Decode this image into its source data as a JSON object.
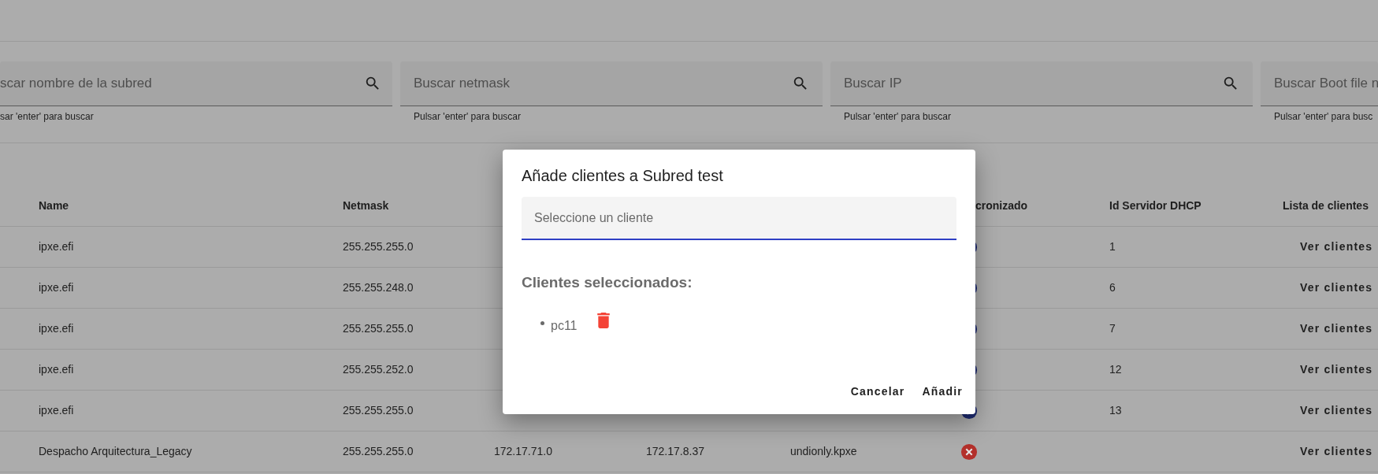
{
  "search_fields": [
    {
      "placeholder": "scar nombre de la subred",
      "helper": "sar 'enter' para buscar"
    },
    {
      "placeholder": "Buscar netmask",
      "helper": "Pulsar 'enter' para buscar"
    },
    {
      "placeholder": "Buscar IP",
      "helper": "Pulsar 'enter' para buscar"
    },
    {
      "placeholder": "Buscar Boot file n",
      "helper": "Pulsar 'enter' para busc"
    }
  ],
  "table": {
    "header": {
      "name": "Name",
      "netmask": "Netmask",
      "synced": "cronizado",
      "dhcp_id": "Id Servidor DHCP",
      "clients": "Lista de clientes"
    },
    "rows": [
      {
        "name": "ipxe.efi",
        "netmask": "255.255.255.0",
        "synced": true,
        "dhcp_id": "1",
        "action": "Ver clientes"
      },
      {
        "name": "ipxe.efi",
        "netmask": "255.255.248.0",
        "synced": true,
        "dhcp_id": "6",
        "action": "Ver clientes"
      },
      {
        "name": "ipxe.efi",
        "netmask": "255.255.255.0",
        "synced": true,
        "dhcp_id": "7",
        "action": "Ver clientes"
      },
      {
        "name": "ipxe.efi",
        "netmask": "255.255.252.0",
        "synced": true,
        "dhcp_id": "12",
        "action": "Ver clientes"
      },
      {
        "name": "ipxe.efi",
        "netmask": "255.255.255.0",
        "synced": true,
        "dhcp_id": "13",
        "action": "Ver clientes"
      },
      {
        "name": "Despacho Arquitectura_Legacy",
        "netmask": "255.255.255.0",
        "column_3": "172.17.71.0",
        "column_4": "172.17.8.37",
        "column_5": "undionly.kpxe",
        "synced": false,
        "action": "Ver clientes"
      }
    ]
  },
  "dialog": {
    "title": "Añade clientes a Subred test",
    "select_placeholder": "Seleccione un cliente",
    "selected_heading": "Clientes seleccionados:",
    "selected_clients": [
      "pc11"
    ],
    "buttons": [
      "Cancelar",
      "Añadir"
    ]
  }
}
